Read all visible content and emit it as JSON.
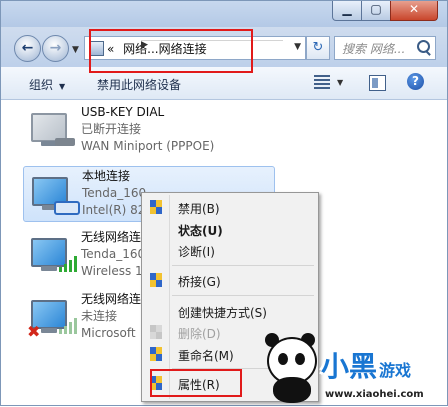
{
  "address": {
    "overflow": "«",
    "crumbs": [
      "网络...",
      "网络连接"
    ]
  },
  "search": {
    "placeholder": "搜索 网络..."
  },
  "toolbar": {
    "organize_label": "组织",
    "disable_label": "禁用此网络设备"
  },
  "connections": [
    {
      "name": "USB-KEY DIAL",
      "status": "已断开连接",
      "device": "WAN Miniport (PPPOE)"
    },
    {
      "name": "本地连接",
      "status": "Tenda_160",
      "device": "Intel(R) 82"
    },
    {
      "name": "无线网络连",
      "status": "Tenda_160",
      "device": "Wireless 1"
    },
    {
      "name": "无线网络连",
      "status": "未连接",
      "device": "Microsoft"
    }
  ],
  "context_menu": {
    "items": [
      {
        "label": "禁用(B)",
        "shield": true,
        "bold": false,
        "disabled": false
      },
      {
        "label": "状态(U)",
        "shield": false,
        "bold": true,
        "disabled": false
      },
      {
        "label": "诊断(I)",
        "shield": false,
        "bold": false,
        "disabled": false
      },
      {
        "label": "桥接(G)",
        "shield": true,
        "bold": false,
        "disabled": false
      },
      {
        "label": "创建快捷方式(S)",
        "shield": false,
        "bold": false,
        "disabled": false
      },
      {
        "label": "删除(D)",
        "shield": true,
        "bold": false,
        "disabled": true
      },
      {
        "label": "重命名(M)",
        "shield": true,
        "bold": false,
        "disabled": false
      },
      {
        "label": "属性(R)",
        "shield": true,
        "bold": false,
        "disabled": false
      }
    ]
  },
  "watermark": {
    "logo_text": "小黑",
    "logo_suffix": "游戏",
    "url": "www.xiaohei.com"
  },
  "colors": {
    "highlight": "#e11a1a",
    "window_chrome": "#bdd0ea",
    "selection": "#cfe3fb"
  }
}
